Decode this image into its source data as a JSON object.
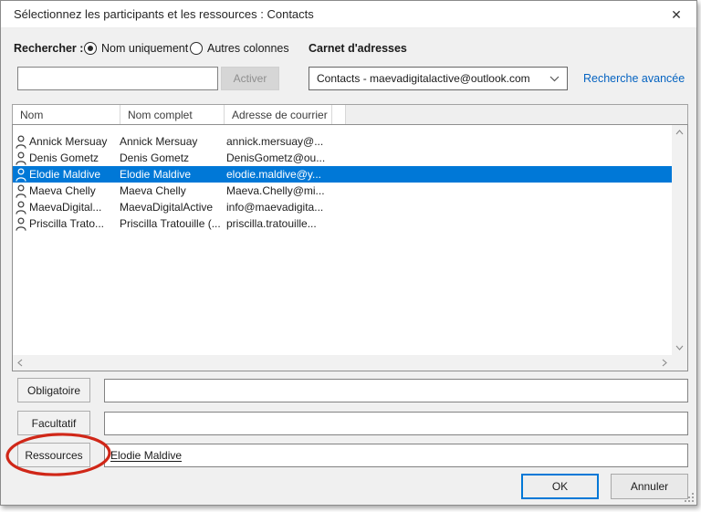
{
  "dialog": {
    "title": "Sélectionnez les participants et les ressources : Contacts"
  },
  "icons": {
    "close": "✕"
  },
  "search": {
    "label": "Rechercher :",
    "options": [
      {
        "label": "Nom uniquement",
        "selected": true
      },
      {
        "label": "Autres colonnes",
        "selected": false
      }
    ],
    "input_value": "",
    "go_button_label": "Activer",
    "go_button_enabled": false
  },
  "address_book": {
    "label": "Carnet d'adresses",
    "selected_value": "Contacts - maevadigitalactive@outlook.com",
    "advanced_search_label": "Recherche avancée"
  },
  "contacts": {
    "columns": [
      "Nom",
      "Nom complet",
      "Adresse de courrier"
    ],
    "rows": [
      {
        "name": "Annick Mersuay",
        "full_name": "Annick Mersuay",
        "email": "annick.mersuay@...",
        "selected": false
      },
      {
        "name": "Denis Gometz",
        "full_name": "Denis Gometz",
        "email": "DenisGometz@ou...",
        "selected": false
      },
      {
        "name": "Elodie Maldive",
        "full_name": "Elodie Maldive",
        "email": "elodie.maldive@y...",
        "selected": true
      },
      {
        "name": "Maeva Chelly",
        "full_name": "Maeva Chelly",
        "email": "Maeva.Chelly@mi...",
        "selected": false
      },
      {
        "name": "MaevaDigital...",
        "full_name": "MaevaDigitalActive",
        "email": "info@maevadigita...",
        "selected": false
      },
      {
        "name": "Priscilla Trato...",
        "full_name": "Priscilla Tratouille (...",
        "email": "priscilla.tratouille...",
        "selected": false
      }
    ]
  },
  "recipients": {
    "required_label": "Obligatoire",
    "required_value": "",
    "optional_label": "Facultatif",
    "optional_value": "",
    "resources_label": "Ressources",
    "resources_value": "Elodie Maldive"
  },
  "footer": {
    "ok_label": "OK",
    "cancel_label": "Annuler"
  },
  "colors": {
    "selection_blue": "#0078d7",
    "link_blue": "#0563c1",
    "annotation_red": "#d02718"
  }
}
